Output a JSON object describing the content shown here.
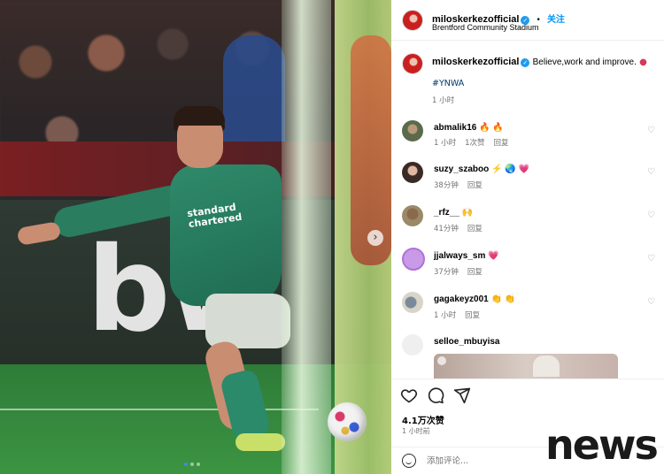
{
  "post": {
    "username": "miloskerkezofficial",
    "follow_label": "关注",
    "location": "Brentford Community Stadium",
    "caption_text": "Believe,work and improve.",
    "hashtag": "#YNWA",
    "caption_time": "1 小时",
    "likes": "4.1万次赞",
    "posted_time": "1 小时前",
    "comment_placeholder": "添加评论..."
  },
  "photo": {
    "billboard_text": "bw",
    "sponsor_text": "standard\nchartered",
    "carousel_dots": 3,
    "active_dot": 1
  },
  "comments": [
    {
      "user": "abmalik16",
      "text": "🔥 🔥",
      "time": "1 小时",
      "likes": "1次赞",
      "reply": "回复"
    },
    {
      "user": "suzy_szaboo",
      "text": "⚡ 🌏 💗",
      "time": "38分钟",
      "reply": "回复"
    },
    {
      "user": "_rfz__",
      "text": "🙌",
      "time": "41分钟",
      "reply": "回复"
    },
    {
      "user": "jjalways_sm",
      "text": "💗",
      "time": "37分钟",
      "reply": "回复"
    },
    {
      "user": "gagakeyz001",
      "text": "👏 👏",
      "time": "1 小时",
      "reply": "回复"
    },
    {
      "user": "selloe_mbuyisa",
      "text": "",
      "time": "",
      "reply": ""
    }
  ],
  "watermark": "news",
  "colors": {
    "accent": "#0095f6",
    "verified": "#1d9bf0",
    "grey_text": "#737373"
  }
}
